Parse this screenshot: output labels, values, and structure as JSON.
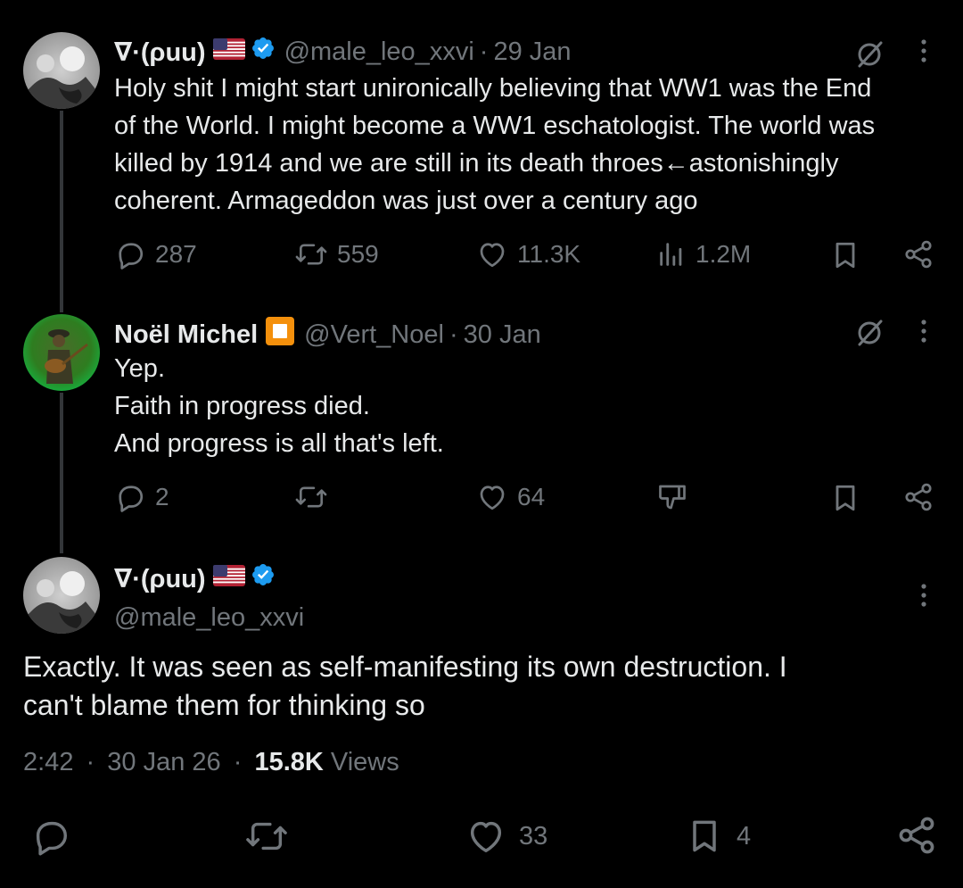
{
  "tweets": [
    {
      "display_name": "∇·(ρuu)",
      "flag": "🇺🇸",
      "handle": "@male_leo_xxvi",
      "date": "29 Jan",
      "lines": [
        "Holy shit I might start unironically believing that WW1 was the End",
        "of the World. I might become a WW1 eschatologist. The world was",
        "killed by 1914 and we are still in its death throes←astonishingly",
        "coherent. Armageddon was just over a century ago"
      ],
      "replies": "287",
      "reposts": "559",
      "likes": "11.3K",
      "views": "1.2M"
    },
    {
      "display_name": "Noël Michel",
      "handle": "@Vert_Noel",
      "date": "30 Jan",
      "lines": [
        "Yep.",
        "Faith in progress died.",
        "And progress is all that's left."
      ],
      "replies": "2",
      "likes": "64"
    }
  ],
  "main_tweet": {
    "display_name": "∇·(ρuu)",
    "flag": "🇺🇸",
    "handle": "@male_leo_xxvi",
    "lines": [
      "Exactly. It was seen as self-manifesting its own destruction. I",
      "can't blame them for thinking so"
    ],
    "time": "2:42",
    "date": "30 Jan 26",
    "views_count": "15.8K",
    "views_label": "Views",
    "likes": "33",
    "bookmarks": "4"
  },
  "colors": {
    "background": "#000000",
    "text": "#e7e9ea",
    "muted": "#71767b",
    "verified": "#1d9bf0",
    "thread_line": "#333639",
    "orange_badge": "#f4900c"
  },
  "icons": {
    "reply": "reply-icon",
    "repost": "repost-icon",
    "like": "heart-icon",
    "views": "views-icon",
    "bookmark": "bookmark-icon",
    "share": "share-icon",
    "grok": "grok-icon",
    "more": "more-icon",
    "dislike": "dislike-icon"
  }
}
